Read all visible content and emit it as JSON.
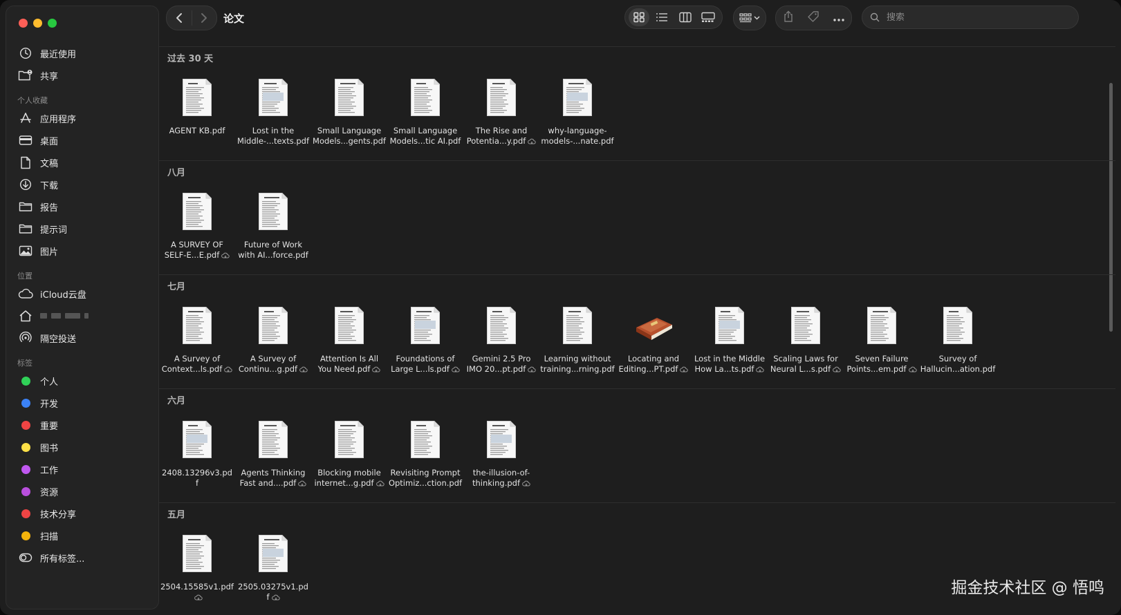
{
  "window": {
    "title": "论文"
  },
  "sidebar": {
    "top_items": [
      {
        "label": "最近使用",
        "icon": "clock-icon"
      },
      {
        "label": "共享",
        "icon": "shared-folder-icon"
      }
    ],
    "favorites_header": "个人收藏",
    "favorites": [
      {
        "label": "应用程序",
        "icon": "applications-icon"
      },
      {
        "label": "桌面",
        "icon": "desktop-icon"
      },
      {
        "label": "文稿",
        "icon": "document-icon"
      },
      {
        "label": "下载",
        "icon": "download-icon"
      },
      {
        "label": "报告",
        "icon": "folder-icon"
      },
      {
        "label": "提示词",
        "icon": "folder-icon"
      },
      {
        "label": "图片",
        "icon": "photo-icon"
      }
    ],
    "locations_header": "位置",
    "locations": [
      {
        "label": "iCloud云盘",
        "icon": "cloud-icon"
      },
      {
        "label": "",
        "icon": "home-icon"
      },
      {
        "label": "隔空投送",
        "icon": "airdrop-icon"
      }
    ],
    "tags_header": "标签",
    "tags": [
      {
        "label": "个人",
        "color": "#30d158"
      },
      {
        "label": "开发",
        "color": "#3b82f6"
      },
      {
        "label": "重要",
        "color": "#ef4444"
      },
      {
        "label": "图书",
        "color": "#fde047"
      },
      {
        "label": "工作",
        "color": "#c058f0"
      },
      {
        "label": "资源",
        "color": "#b94fdd"
      },
      {
        "label": "技术分享",
        "color": "#ef4444"
      },
      {
        "label": "扫描",
        "color": "#f5b40c"
      }
    ],
    "all_tags": "所有标签..."
  },
  "toolbar": {
    "search_placeholder": "搜索",
    "view_modes": [
      "icon",
      "list",
      "column",
      "gallery"
    ],
    "active_view": "icon"
  },
  "groups": [
    {
      "title": "过去 30 天",
      "files": [
        {
          "line1": "AGENT KB.pdf",
          "line2": "",
          "cloud": false
        },
        {
          "line1": "Lost in the",
          "line2": "Middle-...texts.pdf",
          "cloud": false
        },
        {
          "line1": "Small Language",
          "line2": "Models...gents.pdf",
          "cloud": false
        },
        {
          "line1": "Small Language",
          "line2": "Models...tic AI.pdf",
          "cloud": false
        },
        {
          "line1": "The Rise and",
          "line2": "Potentia...y.pdf",
          "cloud": true
        },
        {
          "line1": "why-language-",
          "line2": "models-...nate.pdf",
          "cloud": false
        }
      ]
    },
    {
      "title": "八月",
      "files": [
        {
          "line1": "A SURVEY OF",
          "line2": "SELF-E...E.pdf",
          "cloud": true
        },
        {
          "line1": "Future of Work",
          "line2": "with AI...force.pdf",
          "cloud": false
        }
      ]
    },
    {
      "title": "七月",
      "files": [
        {
          "line1": "A Survey of",
          "line2": "Context...ls.pdf",
          "cloud": true
        },
        {
          "line1": "A Survey of",
          "line2": "Continu...g.pdf",
          "cloud": true
        },
        {
          "line1": "Attention Is All",
          "line2": "You Need.pdf",
          "cloud": true
        },
        {
          "line1": "Foundations of",
          "line2": "Large L...ls.pdf",
          "cloud": true
        },
        {
          "line1": "Gemini 2.5 Pro",
          "line2": "IMO 20...pt.pdf",
          "cloud": true
        },
        {
          "line1": "Learning without",
          "line2": "training...rning.pdf",
          "cloud": false
        },
        {
          "line1": "Locating and",
          "line2": "Editing...PT.pdf",
          "cloud": true,
          "book": true
        },
        {
          "line1": "Lost in the Middle",
          "line2": "How La...ts.pdf",
          "cloud": true
        },
        {
          "line1": "Scaling Laws for",
          "line2": "Neural L...s.pdf",
          "cloud": true
        },
        {
          "line1": "Seven Failure",
          "line2": "Points...em.pdf",
          "cloud": true
        },
        {
          "line1": "Survey of",
          "line2": "Hallucin...ation.pdf",
          "cloud": false
        }
      ]
    },
    {
      "title": "六月",
      "files": [
        {
          "line1": "2408.13296v3.pd",
          "line2": "f",
          "cloud": false
        },
        {
          "line1": "Agents Thinking",
          "line2": "Fast and....pdf",
          "cloud": true
        },
        {
          "line1": "Blocking mobile",
          "line2": "internet...g.pdf",
          "cloud": true
        },
        {
          "line1": "Revisiting Prompt",
          "line2": "Optimiz...ction.pdf",
          "cloud": false
        },
        {
          "line1": "the-illusion-of-",
          "line2": "thinking.pdf",
          "cloud": true
        }
      ]
    },
    {
      "title": "五月",
      "files": [
        {
          "line1": "2504.15585v1.pdf",
          "line2": "",
          "cloud": true
        },
        {
          "line1": "2505.03275v1.pd",
          "line2": "f",
          "cloud": true
        }
      ]
    }
  ],
  "watermark": "掘金技术社区 @ 悟鸣"
}
